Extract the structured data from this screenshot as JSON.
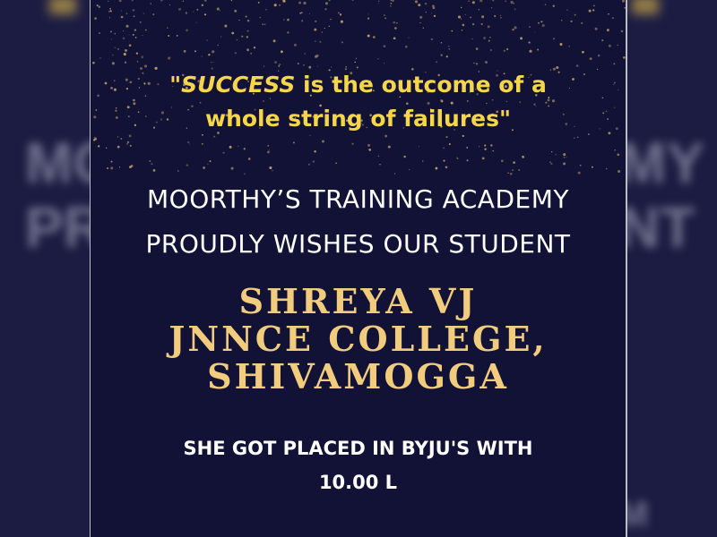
{
  "poster": {
    "quote": {
      "open_quote": "\"",
      "emphasis": "SUCCESS",
      "rest_line1": " is the outcome of a",
      "line2": "whole string of failures\""
    },
    "academy": {
      "line1": "MOORTHY’S TRAINING ACADEMY",
      "line2": "PROUDLY WISHES OUR STUDENT"
    },
    "student": {
      "name": "SHREYA VJ",
      "college": "JNNCE COLLEGE,",
      "city": "SHIVAMOGGA"
    },
    "placement": {
      "line1": "SHE GOT PLACED IN BYJU'S WITH",
      "line2": "10.00 L"
    }
  },
  "background_sides": {
    "left_line1": "MO",
    "left_line2": "PRO",
    "right_line1": "MY",
    "right_line2": "NT",
    "right_line3": "M"
  },
  "colors": {
    "panel_background": "#121237",
    "quote_text": "#f5d64a",
    "student_text": "#f1cc7d",
    "body_text": "#ffffff",
    "stars": "#c9a96b"
  }
}
